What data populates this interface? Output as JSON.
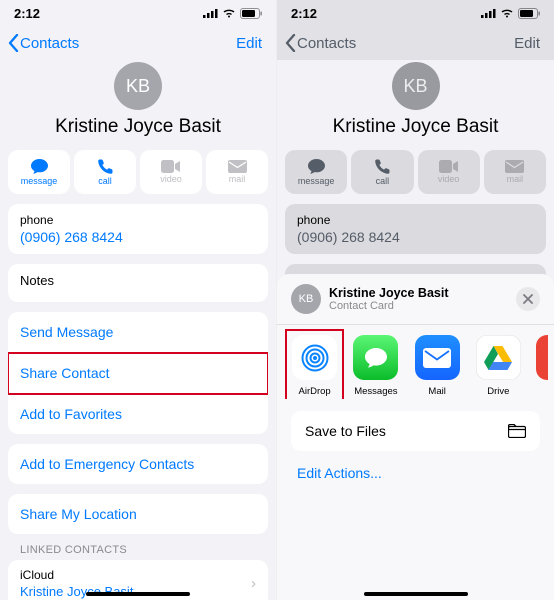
{
  "status": {
    "time": "2:12"
  },
  "nav": {
    "back_label": "Contacts",
    "edit_label": "Edit"
  },
  "contact": {
    "initials": "KB",
    "name": "Kristine Joyce Basit",
    "phone_label": "phone",
    "phone_value": "(0906) 268 8424",
    "notes_label": "Notes"
  },
  "actions": {
    "message": "message",
    "call": "call",
    "video": "video",
    "mail": "mail"
  },
  "menu": {
    "send_message": "Send Message",
    "share_contact": "Share Contact",
    "add_favorites": "Add to Favorites",
    "add_emergency": "Add to Emergency Contacts",
    "share_location": "Share My Location"
  },
  "linked": {
    "header": "LINKED CONTACTS",
    "source": "iCloud",
    "name": "Kristine Joyce Basit"
  },
  "sheet": {
    "title": "Kristine Joyce Basit",
    "subtitle": "Contact Card",
    "options": {
      "airdrop": "AirDrop",
      "messages": "Messages",
      "mail": "Mail",
      "drive": "Drive"
    },
    "save_files": "Save to Files",
    "edit_actions": "Edit Actions..."
  }
}
